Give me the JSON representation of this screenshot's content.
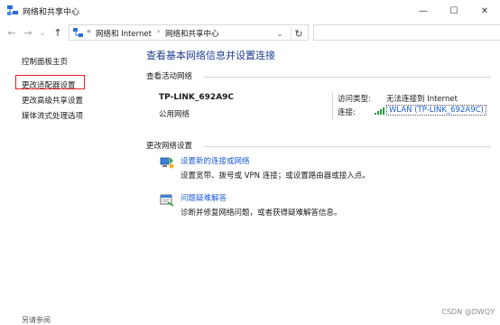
{
  "window": {
    "title": "网络和共享中心"
  },
  "window_controls": {
    "minimize": "—",
    "maximize": "☐",
    "close": "✕"
  },
  "nav": {
    "back": "←",
    "forward": "→",
    "up": "↑",
    "dropdown": "⌄",
    "refresh": "↻",
    "chevron": "›",
    "double_chevron": "«"
  },
  "address": {
    "segments": [
      "网络和 Internet",
      "网络和共享中心"
    ]
  },
  "sidebar": {
    "items": [
      {
        "label": "控制面板主页"
      },
      {
        "label": "更改适配器设置"
      },
      {
        "label": "更改高级共享设置"
      },
      {
        "label": "媒体流式处理选项"
      }
    ],
    "see_also": "另请参阅"
  },
  "main": {
    "title": "查看基本网络信息并设置连接",
    "active_networks_header": "查看活动网络",
    "network": {
      "name": "TP-LINK_692A9C",
      "type": "公用网络",
      "access_type_label": "访问类型:",
      "access_type_value": "无法连接到 Internet",
      "connections_label": "连接:",
      "connection_link": "WLAN (TP-LINK_692A9C)"
    },
    "change_settings_header": "更改网络设置",
    "tasks": [
      {
        "title": "设置新的连接或网络",
        "desc": "设置宽带、拨号或 VPN 连接；或设置路由器或接入点。",
        "icon": "setup-connection-icon"
      },
      {
        "title": "问题疑难解答",
        "desc": "诊断并修复网络问题，或者获得疑难解答信息。",
        "icon": "troubleshoot-icon"
      }
    ]
  },
  "watermark": "CSDN @DWQY",
  "colors": {
    "title_blue": "#1e3f8f",
    "link_blue": "#1d5bd6",
    "highlight_red": "#e02020"
  }
}
